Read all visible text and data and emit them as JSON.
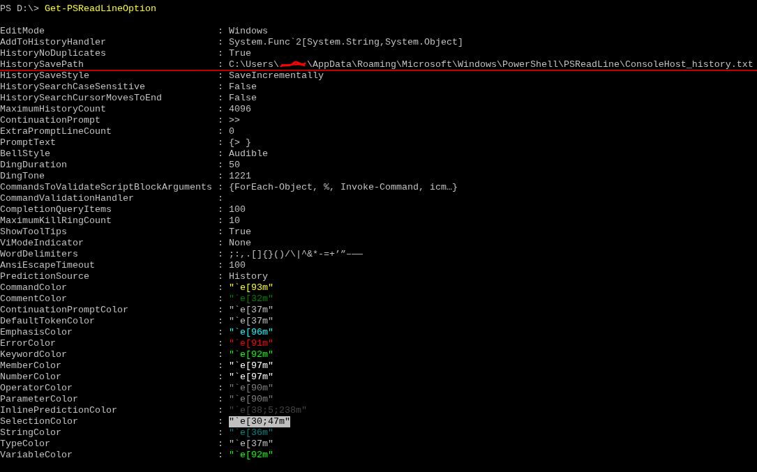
{
  "console": {
    "prompt": "PS D:\\>",
    "command": "Get-PSReadLineOption",
    "separator": ":",
    "options": [
      {
        "name": "EditMode",
        "kind": "text",
        "value": "Windows"
      },
      {
        "name": "AddToHistoryHandler",
        "kind": "text",
        "value": "System.Func`2[System.String,System.Object]"
      },
      {
        "name": "HistoryNoDuplicates",
        "kind": "text",
        "value": "True"
      },
      {
        "name": "HistorySavePath",
        "kind": "redacted",
        "parts": [
          "C:\\Users\\",
          "\\AppData\\Roaming\\Microsoft\\Windows\\PowerShell\\PSReadLine\\ConsoleHost_history.txt"
        ]
      },
      {
        "name": "HistorySaveStyle",
        "kind": "text",
        "value": "SaveIncrementally"
      },
      {
        "name": "HistorySearchCaseSensitive",
        "kind": "text",
        "value": "False"
      },
      {
        "name": "HistorySearchCursorMovesToEnd",
        "kind": "text",
        "value": "False"
      },
      {
        "name": "MaximumHistoryCount",
        "kind": "text",
        "value": "4096"
      },
      {
        "name": "ContinuationPrompt",
        "kind": "text",
        "value": ">>"
      },
      {
        "name": "ExtraPromptLineCount",
        "kind": "text",
        "value": "0"
      },
      {
        "name": "PromptText",
        "kind": "text",
        "value": "{> }"
      },
      {
        "name": "BellStyle",
        "kind": "text",
        "value": "Audible"
      },
      {
        "name": "DingDuration",
        "kind": "text",
        "value": "50"
      },
      {
        "name": "DingTone",
        "kind": "text",
        "value": "1221"
      },
      {
        "name": "CommandsToValidateScriptBlockArguments",
        "kind": "text",
        "value": "{ForEach-Object, %, Invoke-Command, icm…}"
      },
      {
        "name": "CommandValidationHandler",
        "kind": "empty"
      },
      {
        "name": "CompletionQueryItems",
        "kind": "text",
        "value": "100"
      },
      {
        "name": "MaximumKillRingCount",
        "kind": "text",
        "value": "10"
      },
      {
        "name": "ShowToolTips",
        "kind": "text",
        "value": "True"
      },
      {
        "name": "ViModeIndicator",
        "kind": "text",
        "value": "None"
      },
      {
        "name": "WordDelimiters",
        "kind": "text",
        "value": ";:,.[]{}()/\\|^&*-=+’”–—―"
      },
      {
        "name": "AnsiEscapeTimeout",
        "kind": "text",
        "value": "100"
      },
      {
        "name": "PredictionSource",
        "kind": "text",
        "value": "History"
      },
      {
        "name": "CommandColor",
        "kind": "color",
        "value": "\"`e[93m\"",
        "color": "#ffff00"
      },
      {
        "name": "CommentColor",
        "kind": "color",
        "value": "\"`e[32m\"",
        "color": "#008000"
      },
      {
        "name": "ContinuationPromptColor",
        "kind": "color",
        "value": "\"`e[37m\"",
        "color": "#c0c0c0"
      },
      {
        "name": "DefaultTokenColor",
        "kind": "color",
        "value": "\"`e[37m\"",
        "color": "#c0c0c0"
      },
      {
        "name": "EmphasisColor",
        "kind": "color",
        "value": "\"`e[96m\"",
        "color": "#00ffff"
      },
      {
        "name": "ErrorColor",
        "kind": "color",
        "value": "\"`e[91m\"",
        "color": "#ff0000"
      },
      {
        "name": "KeywordColor",
        "kind": "color",
        "value": "\"`e[92m\"",
        "color": "#00ff00"
      },
      {
        "name": "MemberColor",
        "kind": "color",
        "value": "\"`e[97m\"",
        "color": "#ffffff"
      },
      {
        "name": "NumberColor",
        "kind": "color",
        "value": "\"`e[97m\"",
        "color": "#ffffff"
      },
      {
        "name": "OperatorColor",
        "kind": "color",
        "value": "\"`e[90m\"",
        "color": "#808080"
      },
      {
        "name": "ParameterColor",
        "kind": "color",
        "value": "\"`e[90m\"",
        "color": "#808080"
      },
      {
        "name": "InlinePredictionColor",
        "kind": "color",
        "value": "\"`e[38;5;238m\"",
        "color": "#444444"
      },
      {
        "name": "SelectionColor",
        "kind": "inverse",
        "value": "\"`e[30;47m\"",
        "color": "#000000"
      },
      {
        "name": "StringColor",
        "kind": "color",
        "value": "\"`e[36m\"",
        "color": "#008080"
      },
      {
        "name": "TypeColor",
        "kind": "color",
        "value": "\"`e[37m\"",
        "color": "#c0c0c0"
      },
      {
        "name": "VariableColor",
        "kind": "color",
        "value": "\"`e[92m\"",
        "color": "#00ff00"
      }
    ]
  }
}
